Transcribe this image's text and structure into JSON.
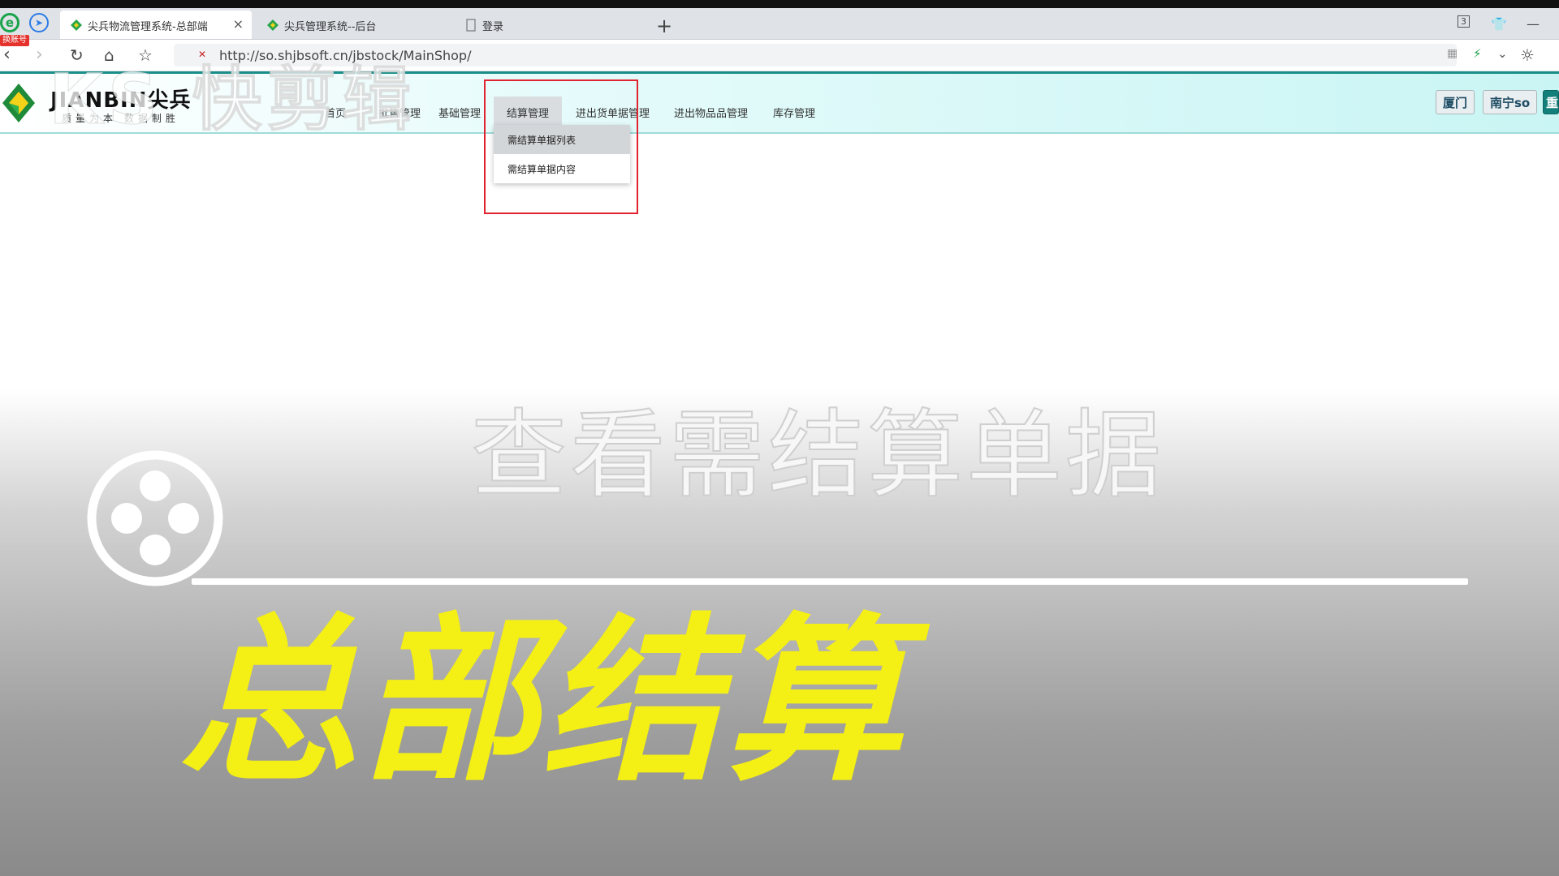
{
  "browser": {
    "badge": "换账号",
    "tabs": [
      {
        "title": "尖兵物流管理系统-总部端",
        "active": true
      },
      {
        "title": "尖兵管理系统--后台",
        "active": false
      },
      {
        "title": "登录",
        "active": false
      }
    ],
    "new_tab": "+",
    "tab_count": "3",
    "url": "http://so.shjbsoft.cn/jbstock/MainShop/"
  },
  "app": {
    "logo_text": "JIANBIN尖兵",
    "logo_sub": "质量为本 数据制胜",
    "menu": [
      {
        "label": "首页"
      },
      {
        "label": "批售管理"
      },
      {
        "label": "基础管理"
      },
      {
        "label": "结算管理",
        "active": true
      },
      {
        "label": "进出货单据管理"
      },
      {
        "label": "进出物品品管理"
      },
      {
        "label": "库存管理"
      }
    ],
    "header_buttons": [
      "厦门",
      "南宁so",
      "重"
    ],
    "dropdown": [
      {
        "label": "需结算单据列表",
        "hover": true
      },
      {
        "label": "需结算单据内容",
        "hover": false
      }
    ]
  },
  "overlay": {
    "watermark": "KS 快剪辑",
    "subtitle": "查看需结算单据",
    "title": "总部结算"
  },
  "colors": {
    "title_yellow": "#f4ef14",
    "highlight_red": "#e0232e",
    "header_teal": "#1a8f8a"
  }
}
